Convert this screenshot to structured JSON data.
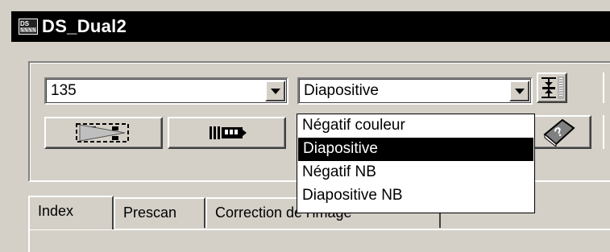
{
  "window": {
    "title": "DS_Dual2",
    "app_icon": "scanner-app-icon"
  },
  "film_size": {
    "value": "135"
  },
  "film_type": {
    "value": "Diapositive",
    "options": [
      "Négatif couleur",
      "Diapositive",
      "Négatif NB",
      "Diapositive NB"
    ],
    "selected_index": 1
  },
  "toolbar": {
    "autofocus_icon": "focus-slider-icon",
    "prescan_icon": "prescan-play-icon",
    "filmstrip_icon": "filmstrip-advance-icon",
    "help_icon": "help-book-icon"
  },
  "tabs": [
    {
      "label": "Index"
    },
    {
      "label": "Prescan"
    },
    {
      "label": "Correction de l'image"
    }
  ]
}
